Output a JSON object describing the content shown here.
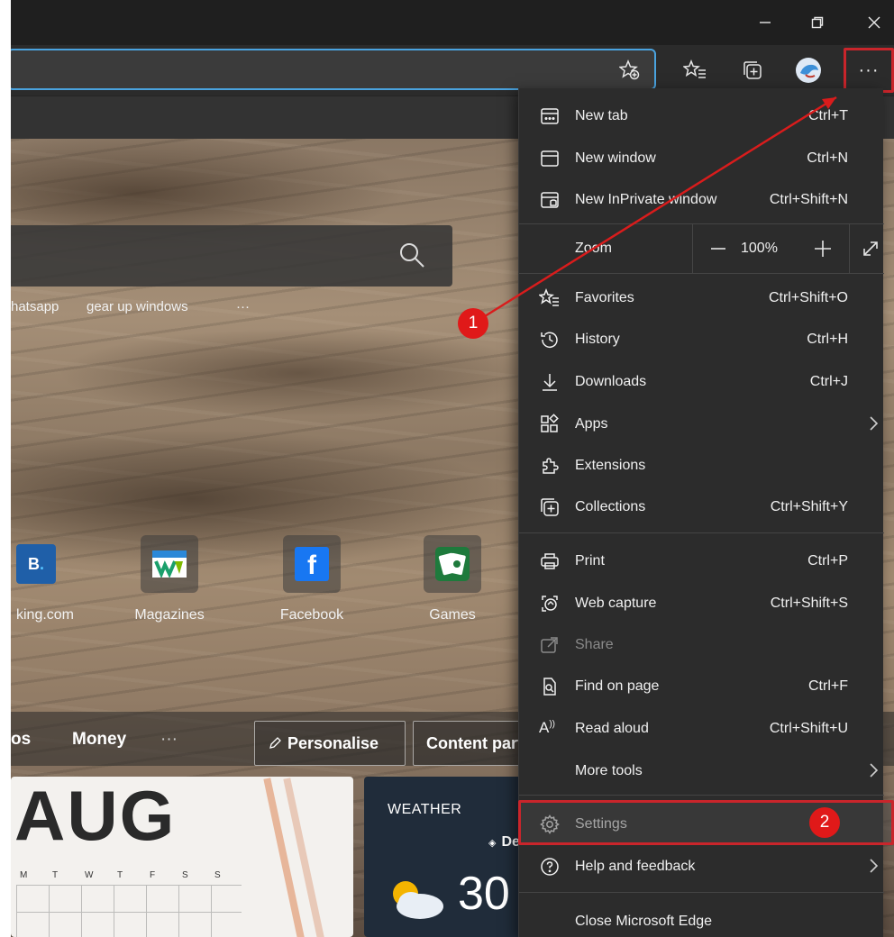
{
  "window": {
    "minimize_icon": "minimize-icon",
    "restore_icon": "restore-icon",
    "close_icon": "close-icon"
  },
  "toolbar": {
    "more_label": "···"
  },
  "page": {
    "quick_links": [
      "hatsapp",
      "gear up windows",
      "···"
    ],
    "tiles": [
      "king.com",
      "Magazines",
      "Facebook",
      "Games"
    ],
    "news": {
      "item1": "os",
      "item2": "Money",
      "more": "···",
      "personalise": "Personalise",
      "content": "Content part"
    },
    "calendar": {
      "month": "AUG",
      "days": [
        "M",
        "T",
        "W",
        "T",
        "F",
        "S",
        "S"
      ]
    },
    "weather": {
      "title": "WEATHER",
      "location": "De",
      "temp": "30"
    }
  },
  "menu": {
    "items": [
      {
        "label": "New tab",
        "shortcut": "Ctrl+T"
      },
      {
        "label": "New window",
        "shortcut": "Ctrl+N"
      },
      {
        "label": "New InPrivate window",
        "shortcut": "Ctrl+Shift+N"
      },
      {
        "label": "Favorites",
        "shortcut": "Ctrl+Shift+O"
      },
      {
        "label": "History",
        "shortcut": "Ctrl+H"
      },
      {
        "label": "Downloads",
        "shortcut": "Ctrl+J"
      },
      {
        "label": "Apps",
        "shortcut": ""
      },
      {
        "label": "Extensions",
        "shortcut": ""
      },
      {
        "label": "Collections",
        "shortcut": "Ctrl+Shift+Y"
      },
      {
        "label": "Print",
        "shortcut": "Ctrl+P"
      },
      {
        "label": "Web capture",
        "shortcut": "Ctrl+Shift+S"
      },
      {
        "label": "Share",
        "shortcut": ""
      },
      {
        "label": "Find on page",
        "shortcut": "Ctrl+F"
      },
      {
        "label": "Read aloud",
        "shortcut": "Ctrl+Shift+U"
      },
      {
        "label": "More tools",
        "shortcut": ""
      },
      {
        "label": "Settings",
        "shortcut": ""
      },
      {
        "label": "Help and feedback",
        "shortcut": ""
      },
      {
        "label": "Close Microsoft Edge",
        "shortcut": ""
      }
    ],
    "zoom": {
      "label": "Zoom",
      "value": "100%"
    }
  },
  "annotations": {
    "badge1": "1",
    "badge2": "2",
    "accent_color": "#c9252b"
  }
}
